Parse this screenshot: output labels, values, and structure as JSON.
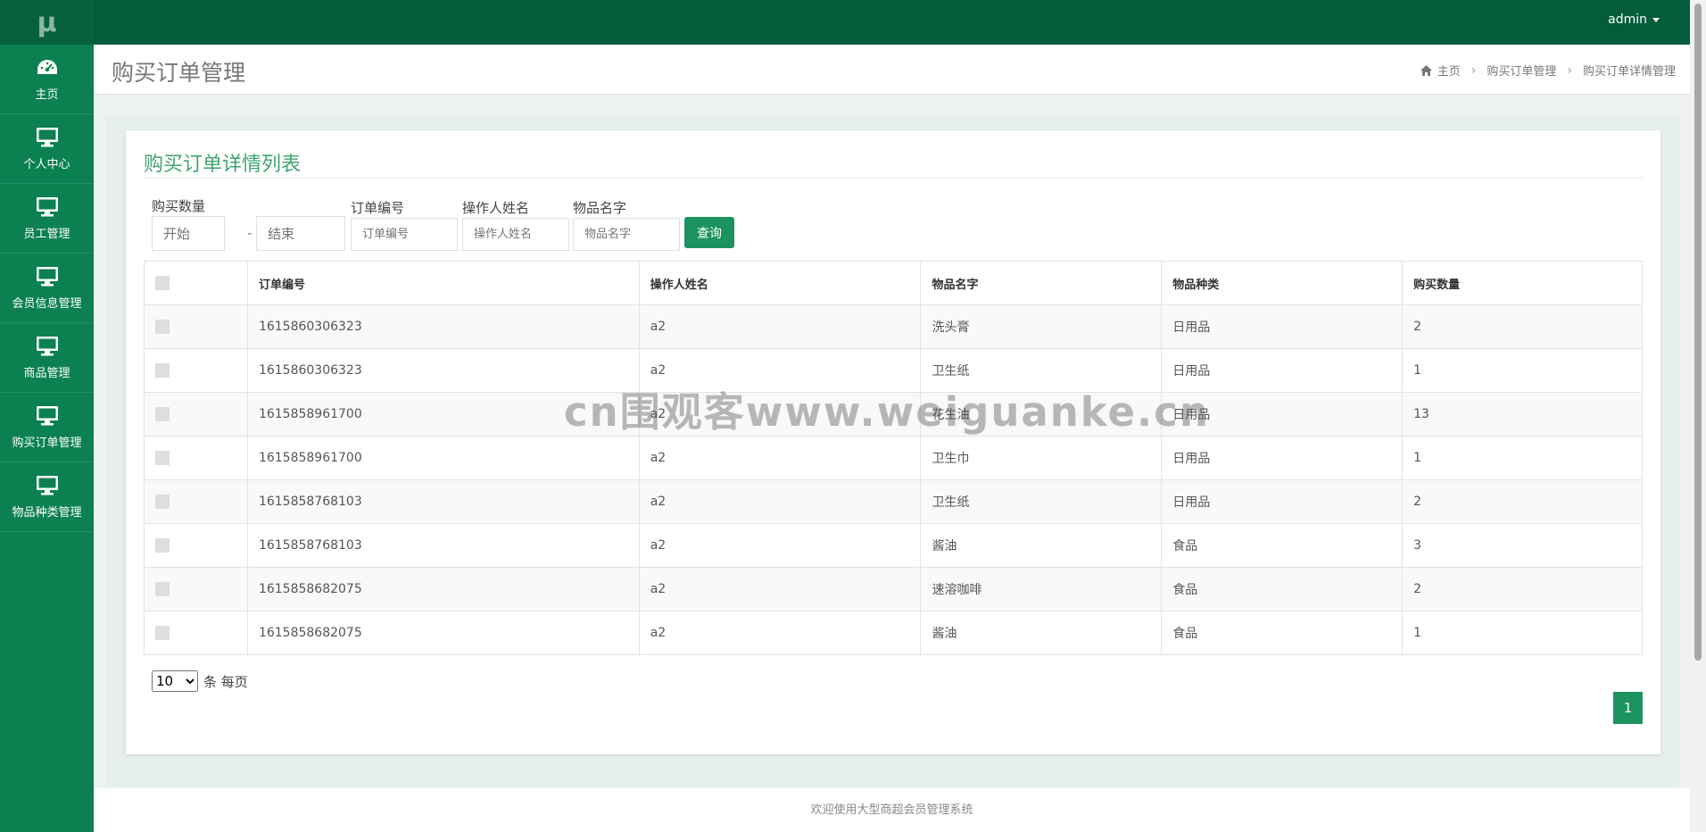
{
  "brand": {
    "logo": "μ"
  },
  "sidebar": {
    "items": [
      {
        "label": "主页",
        "icon": "dashboard-icon"
      },
      {
        "label": "个人中心",
        "icon": "monitor-icon"
      },
      {
        "label": "员工管理",
        "icon": "monitor-icon"
      },
      {
        "label": "会员信息管理",
        "icon": "monitor-icon"
      },
      {
        "label": "商品管理",
        "icon": "monitor-icon"
      },
      {
        "label": "购买订单管理",
        "icon": "monitor-icon"
      },
      {
        "label": "物品种类管理",
        "icon": "monitor-icon"
      }
    ]
  },
  "topbar": {
    "user": "admin"
  },
  "header": {
    "title": "购买订单管理",
    "breadcrumb": [
      "主页",
      "购买订单管理",
      "购买订单详情管理"
    ]
  },
  "panel": {
    "title": "购买订单详情列表"
  },
  "filters": {
    "quantity_label": "购买数量",
    "quantity_start_placeholder": "开始",
    "quantity_end_placeholder": "结束",
    "order_no_label": "订单编号",
    "order_no_placeholder": "订单编号",
    "operator_label": "操作人姓名",
    "operator_placeholder": "操作人姓名",
    "item_label": "物品名字",
    "item_placeholder": "物品名字",
    "search_button": "查询"
  },
  "table": {
    "columns": [
      "订单编号",
      "操作人姓名",
      "物品名字",
      "物品种类",
      "购买数量"
    ],
    "rows": [
      [
        "1615860306323",
        "a2",
        "洗头膏",
        "日用品",
        "2"
      ],
      [
        "1615860306323",
        "a2",
        "卫生纸",
        "日用品",
        "1"
      ],
      [
        "1615858961700",
        "a2",
        "花生油",
        "日用品",
        "13"
      ],
      [
        "1615858961700",
        "a2",
        "卫生巾",
        "日用品",
        "1"
      ],
      [
        "1615858768103",
        "a2",
        "卫生纸",
        "日用品",
        "2"
      ],
      [
        "1615858768103",
        "a2",
        "酱油",
        "食品",
        "3"
      ],
      [
        "1615858682075",
        "a2",
        "速溶咖啡",
        "食品",
        "2"
      ],
      [
        "1615858682075",
        "a2",
        "酱油",
        "食品",
        "1"
      ]
    ]
  },
  "pagination": {
    "page_size": "10",
    "page_size_suffix": "条 每页",
    "current_page": "1"
  },
  "footer": {
    "text": "欢迎使用大型商超会员管理系统"
  },
  "watermark": {
    "text": "cn围观客www.weiguanke.cn"
  },
  "colors": {
    "sidebar": "#0b8050",
    "topbar": "#045c3b",
    "accent": "#1c9360",
    "title": "#3ea46f"
  }
}
